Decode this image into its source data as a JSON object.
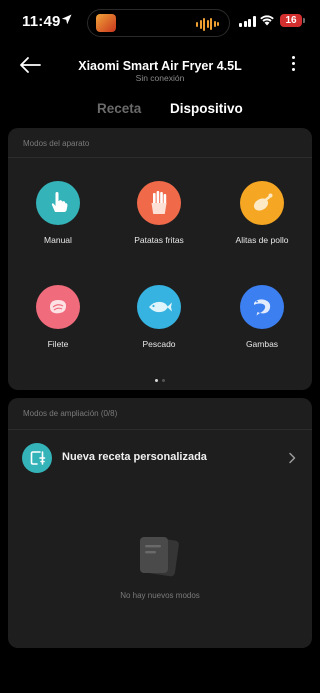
{
  "status_bar": {
    "time": "11:49",
    "battery": "16"
  },
  "header": {
    "title": "Xiaomi Smart Air Fryer 4.5L",
    "subtitle": "Sin conexión"
  },
  "tabs": [
    {
      "label": "Receta"
    },
    {
      "label": "Dispositivo"
    }
  ],
  "modes_section": {
    "title": "Modos del aparato",
    "modes": [
      {
        "label": "Manual",
        "icon": "hand-pointer-icon",
        "color": "#34b3b8"
      },
      {
        "label": "Patatas fritas",
        "icon": "fries-icon",
        "color": "#f06a4a"
      },
      {
        "label": "Alitas de pollo",
        "icon": "chicken-wing-icon",
        "color": "#f5a623"
      },
      {
        "label": "Filete",
        "icon": "steak-icon",
        "color": "#f06b7b"
      },
      {
        "label": "Pescado",
        "icon": "fish-icon",
        "color": "#36b3e0"
      },
      {
        "label": "Gambas",
        "icon": "shrimp-icon",
        "color": "#3c7ff0"
      }
    ],
    "page_count": 2,
    "active_page": 1
  },
  "extension_section": {
    "title": "Modos de ampliación (0/8)",
    "new_recipe_label": "Nueva receta personalizada",
    "empty_text": "No hay nuevos modos"
  },
  "colors": {
    "background": "#000000",
    "card": "#1e1e1e",
    "accent": "#34b3b8",
    "battery_low": "#d32f2f"
  }
}
